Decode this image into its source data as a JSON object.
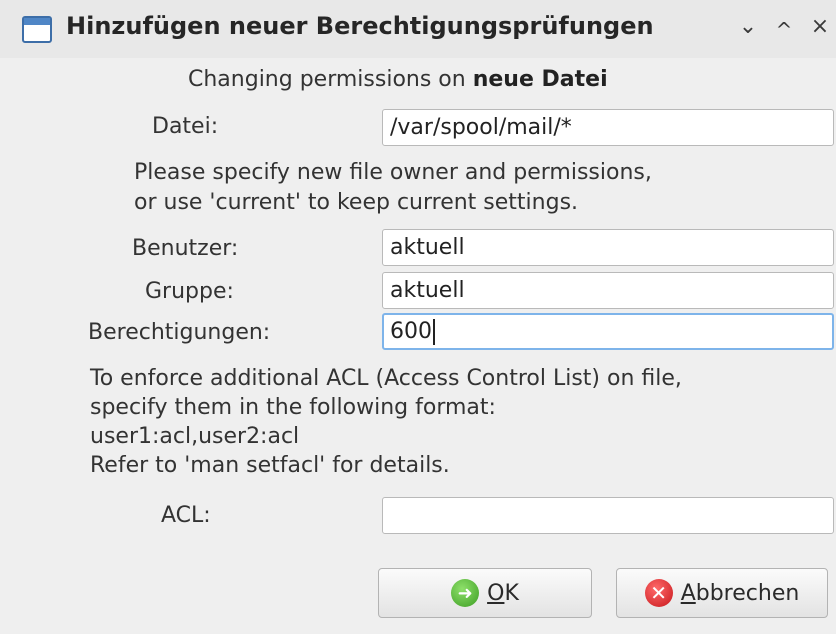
{
  "window": {
    "title": "Hinzufügen neuer Berechtigungsprüfungen",
    "controls": {
      "minimize": "⌄",
      "maximize": "^",
      "close": "×"
    }
  },
  "heading": {
    "prefix": "Changing permissions on ",
    "filename": "neue Datei"
  },
  "file": {
    "label": "Datei:",
    "value": "/var/spool/mail/*"
  },
  "instructions": {
    "line1": "Please specify new file owner and permissions,",
    "line2": "or use 'current' to keep current settings."
  },
  "user": {
    "label": "Benutzer:",
    "value": "aktuell"
  },
  "group": {
    "label": "Gruppe:",
    "value": "aktuell"
  },
  "permissions": {
    "label": "Berechtigungen:",
    "value": "600"
  },
  "acl_info": {
    "line1": "To enforce additional ACL (Access Control List) on file,",
    "line2": "specify them in the following format:",
    "line3": "user1:acl,user2:acl",
    "line4": "Refer to 'man setfacl' for details."
  },
  "acl": {
    "label": "ACL:",
    "value": ""
  },
  "buttons": {
    "ok": {
      "mnemonic": "O",
      "rest": "K",
      "icon": "ok-arrow-icon"
    },
    "cancel": {
      "mnemonic": "A",
      "rest": "bbrechen",
      "icon": "cancel-x-icon"
    }
  }
}
